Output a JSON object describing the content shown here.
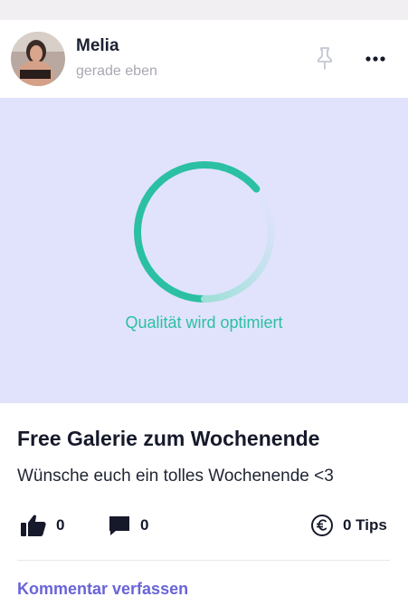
{
  "post": {
    "author": "Melia",
    "time": "gerade eben",
    "media_status": "Qualität wird optimiert",
    "title": "Free Galerie zum Wochenende",
    "description": "Wünsche euch ein tolles Wochenende <3",
    "likes": "0",
    "comments": "0",
    "tips": "0 Tips",
    "comment_link": "Kommentar verfassen"
  },
  "icons": {
    "pin": "pin-icon",
    "more": "more-options-icon",
    "like": "thumbs-up-icon",
    "comment": "comment-icon",
    "tip": "euro-coin-icon"
  },
  "colors": {
    "accent": "#6a64d8",
    "loading": "#2bc0a3",
    "media_bg": "#e1e3fc"
  }
}
